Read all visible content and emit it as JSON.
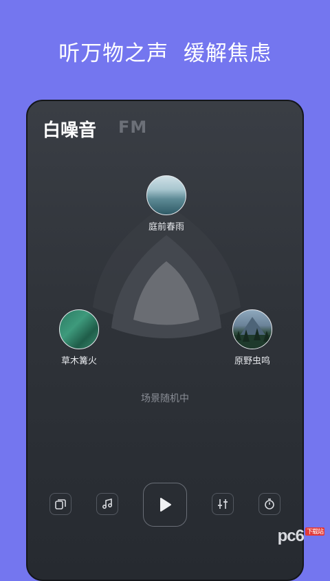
{
  "headline": "听万物之声  缓解焦虑",
  "tabs": [
    {
      "label": "白噪音",
      "active": true
    },
    {
      "label": "FM",
      "active": false
    }
  ],
  "sounds": {
    "top": {
      "label": "庭前春雨",
      "image": "misty lake"
    },
    "left": {
      "label": "草木篝火",
      "image": "green leaves"
    },
    "right": {
      "label": "原野虫鸣",
      "image": "mountain forest"
    }
  },
  "status_text": "场景随机中",
  "controls": {
    "scene_icon": "cards-icon",
    "music_icon": "music-note-icon",
    "play_icon": "play-icon",
    "mixer_icon": "sliders-icon",
    "timer_icon": "stopwatch-icon"
  },
  "watermark": {
    "text": "pc6",
    "badge": "下载站"
  },
  "colors": {
    "background": "#7476ef",
    "card": "#2f3339",
    "text_primary": "#ffffff",
    "text_muted": "#8a8e96"
  }
}
